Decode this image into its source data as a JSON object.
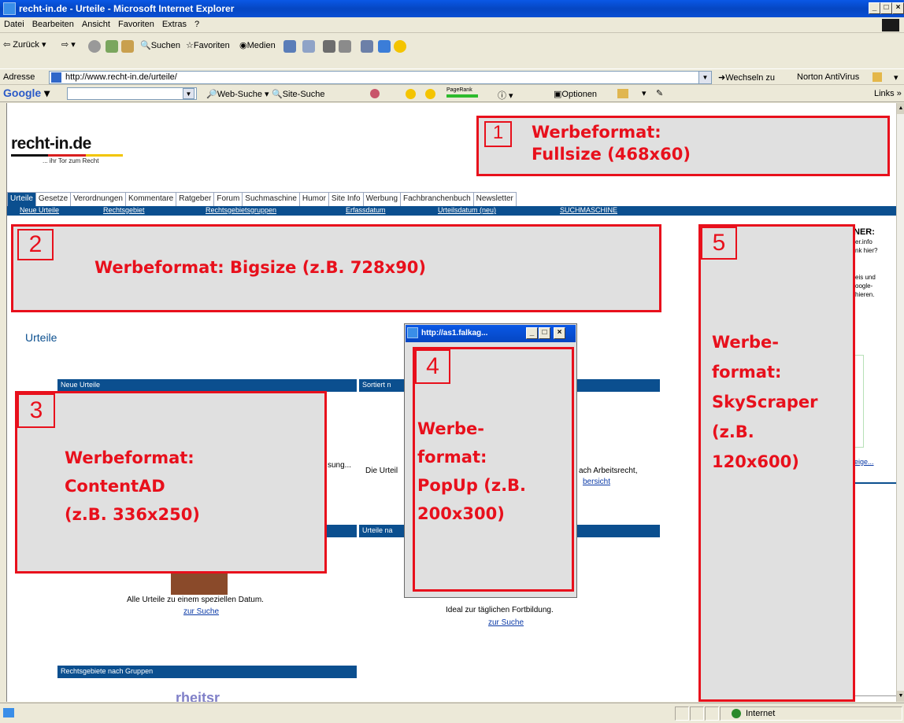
{
  "window": {
    "title": "recht-in.de - Urteile - Microsoft Internet Explorer",
    "controls": [
      "_",
      "□",
      "×"
    ]
  },
  "menubar": {
    "items": [
      "Datei",
      "Bearbeiten",
      "Ansicht",
      "Favoriten",
      "Extras",
      "?"
    ]
  },
  "toolbar": {
    "back": "Zurück",
    "search": "Suchen",
    "favorites": "Favoriten",
    "media": "Medien"
  },
  "addressbar": {
    "label": "Adresse",
    "url": "http://www.recht-in.de/urteile/",
    "go": "Wechseln zu",
    "norton": "Norton AntiVirus",
    "links": "Links"
  },
  "googlebar": {
    "logo": "Google",
    "web_search": "Web-Suche",
    "site_search": "Site-Suche",
    "pagerank": "PageRank",
    "options": "Optionen"
  },
  "page": {
    "logo": {
      "name": "recht-in.de",
      "tagline": "... ihr Tor zum Recht",
      "bar_colors": [
        "#111111",
        "#d81e1e",
        "#f2c500"
      ]
    },
    "nav_tabs": [
      "Urteile",
      "Gesetze",
      "Verordnungen",
      "Kommentare",
      "Ratgeber",
      "Forum",
      "Suchmaschine",
      "Humor",
      "Site Info",
      "Werbung",
      "Fachbranchenbuch",
      "Newsletter"
    ],
    "subnav": [
      "Neue Urteile",
      "Rechtsgebiet",
      "Rechtsgebietsgruppen",
      "Erfassdatum",
      "Urteilsdatum (neu)",
      "SUCHMASCHINE"
    ],
    "heading": "Urteile",
    "sections": {
      "neue_urteile": "Neue Urteile",
      "sortiert": "Sortiert n",
      "urteile_na": "Urteile na",
      "gruppen": "Rechtsgebiete nach Gruppen"
    },
    "fragments": {
      "sung": "sung...",
      "die_urteil": "Die Urteil",
      "arbeitsrecht": "ach Arbeitsrecht,",
      "bersicht": "bersicht",
      "datum_text": "Alle Urteile zu einem speziellen Datum.",
      "zur_suche_1": "zur Suche",
      "fortbildung": "Ideal zur täglichen Fortbildung.",
      "zur_suche_2": "zur Suche",
      "partner": "NER:",
      "partner_1": "er.info",
      "partner_2": "nk hier?",
      "partner_3": "eis und",
      "partner_4": "oogle-",
      "partner_5": "hieren.",
      "anzeige": "eige...",
      "bottom_logo": "rheitsr"
    },
    "popup": {
      "title": "http://as1.falkag..."
    }
  },
  "ads": [
    {
      "number": "1",
      "label": "Werbeformat:\nFullsize (468x60)"
    },
    {
      "number": "2",
      "label": "Werbeformat: Bigsize (z.B. 728x90)"
    },
    {
      "number": "3",
      "label": "Werbeformat:\nContentAD\n(z.B. 336x250)"
    },
    {
      "number": "4",
      "label": "Werbe-\nformat:\nPopUp (z.B.\n200x300)"
    },
    {
      "number": "5",
      "label": "Werbe-\nformat:\nSkyScraper\n(z.B.\n120x600)"
    }
  ],
  "statusbar": {
    "zone": "Internet"
  }
}
